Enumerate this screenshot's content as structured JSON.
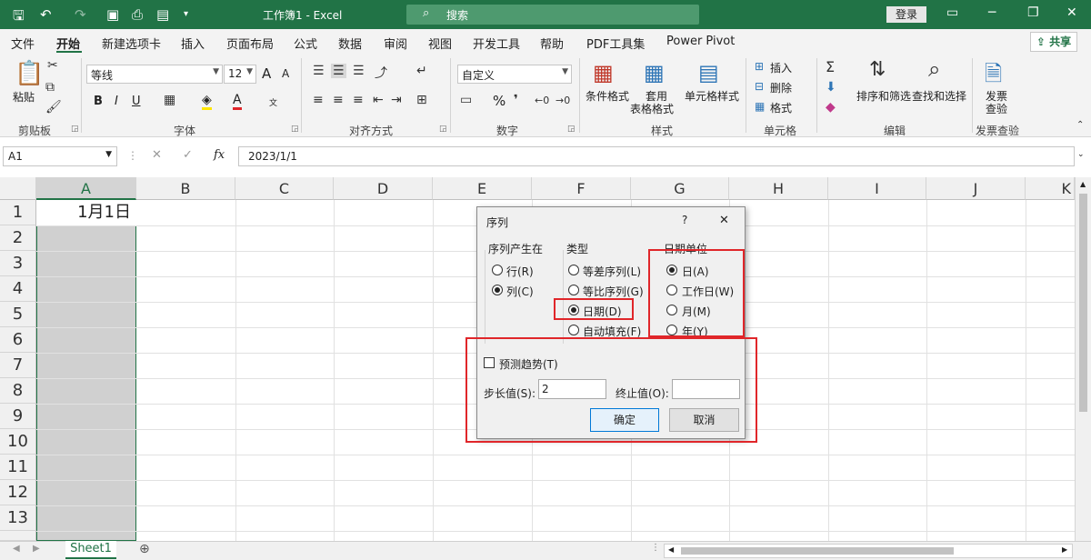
{
  "titlebar": {
    "doc_title": "工作簿1 - Excel",
    "search_placeholder": "搜索",
    "login": "登录"
  },
  "tabs": [
    "文件",
    "开始",
    "新建选项卡",
    "插入",
    "页面布局",
    "公式",
    "数据",
    "审阅",
    "视图",
    "开发工具",
    "帮助",
    "PDF工具集",
    "Power Pivot"
  ],
  "share": "共享",
  "ribbon": {
    "clipboard": {
      "paste": "粘贴",
      "label": "剪贴板"
    },
    "font": {
      "name": "等线",
      "size": "12",
      "bold": "B",
      "italic": "I",
      "underline": "U",
      "label": "字体",
      "grow": "A",
      "shrink": "A",
      "phonetic": "文"
    },
    "alignment": {
      "label": "对齐方式"
    },
    "number": {
      "format": "自定义",
      "percent": "%",
      "label": "数字"
    },
    "styles": {
      "conditional": "条件格式",
      "table_format1": "套用",
      "table_format2": "表格格式",
      "cell_styles": "单元格样式",
      "label": "样式"
    },
    "cells": {
      "insert": "插入",
      "delete": "删除",
      "format": "格式",
      "label": "单元格"
    },
    "editing": {
      "sort": "排序和筛选",
      "find": "查找和选择",
      "label": "编辑"
    },
    "invoice": {
      "line1": "发票",
      "line2": "查验",
      "label": "发票查验"
    }
  },
  "formula_bar": {
    "name_box": "A1",
    "fx": "fx",
    "value": "2023/1/1"
  },
  "columns": [
    "A",
    "B",
    "C",
    "D",
    "E",
    "F",
    "G",
    "H",
    "I",
    "J",
    "K"
  ],
  "rows": [
    "1",
    "2",
    "3",
    "4",
    "5",
    "6",
    "7",
    "8",
    "9",
    "10",
    "11",
    "12",
    "13"
  ],
  "cell_a1": "1月1日",
  "sheet_tab": "Sheet1",
  "add_sheet": "⊕",
  "dialog": {
    "title": "序列",
    "help": "?",
    "close": "✕",
    "series_in": {
      "label": "序列产生在",
      "row": "行(R)",
      "col": "列(C)",
      "selected": "列(C)"
    },
    "type": {
      "label": "类型",
      "linear": "等差序列(L)",
      "growth": "等比序列(G)",
      "date": "日期(D)",
      "autofill": "自动填充(F)",
      "selected": "日期(D)"
    },
    "date_unit": {
      "label": "日期单位",
      "day": "日(A)",
      "weekday": "工作日(W)",
      "month": "月(M)",
      "year": "年(Y)",
      "selected": "日(A)"
    },
    "trend": "预测趋势(T)",
    "step_label": "步长值(S):",
    "step_value": "2",
    "stop_label": "终止值(O):",
    "stop_value": "",
    "ok": "确定",
    "cancel": "取消"
  },
  "colors": {
    "accent": "#217346",
    "highlight": "#e0262a"
  }
}
